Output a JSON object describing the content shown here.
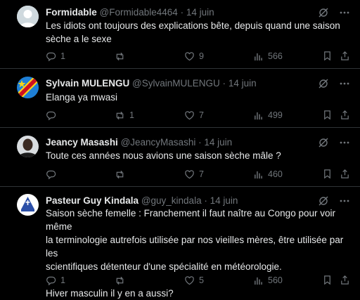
{
  "tweets": [
    {
      "name": "Formidable",
      "handle": "@Formidable4464",
      "sep": "·",
      "date": "14 juin",
      "text_lines": [
        "Les idiots ont toujours des explications bête,  depuis quand une saison",
        "sèche a le sexe"
      ],
      "replies": "1",
      "reposts": "",
      "likes": "9",
      "views": "566"
    },
    {
      "name": "Sylvain MULENGU",
      "handle": "@SylvainMULENGU",
      "sep": "·",
      "date": "14 juin",
      "text_lines": [
        "Elanga ya mwasi"
      ],
      "replies": "",
      "reposts": "1",
      "likes": "7",
      "views": "499"
    },
    {
      "name": "Jeancy Masashi",
      "handle": "@JeancyMasashi",
      "sep": "·",
      "date": "14 juin",
      "text_lines": [
        "Toute ces années nous avions une saison sèche mâle ?"
      ],
      "replies": "",
      "reposts": "",
      "likes": "7",
      "views": "460"
    },
    {
      "name": "Pasteur Guy Kindala",
      "handle": "@guy_kindala",
      "sep": "·",
      "date": "14 juin",
      "text_lines": [
        "Saison sèche femelle : Franchement il faut naître au Congo pour voir même",
        "la terminologie autrefois utilisée par nos vieilles mères, être utilisée par les",
        "scientifiques détenteur d'une spécialité en météorologie.",
        "",
        "Hiver masculin il y en a aussi?"
      ],
      "replies": "1",
      "reposts": "",
      "likes": "5",
      "views": "560"
    }
  ],
  "icons": {
    "grok": "grok-icon",
    "more": "more-icon",
    "reply": "reply-icon",
    "repost": "repost-icon",
    "like": "like-icon",
    "views": "views-icon",
    "bookmark": "bookmark-icon",
    "share": "share-icon"
  },
  "colors": {
    "background": "#000000",
    "text": "#e7e9ea",
    "muted": "#71767b",
    "divider": "#2f3336"
  }
}
